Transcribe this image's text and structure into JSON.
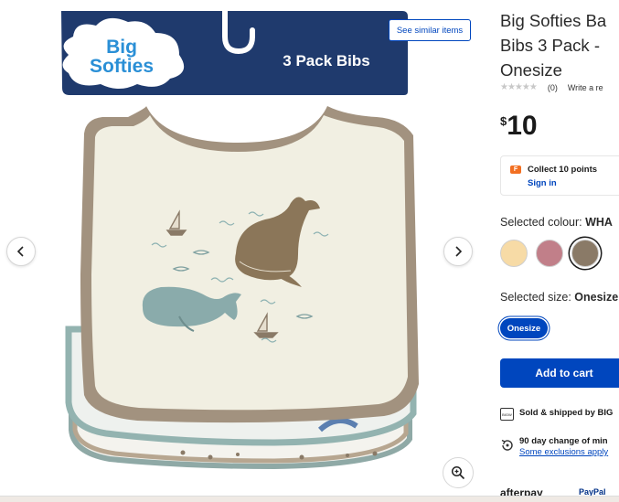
{
  "gallery": {
    "see_similar_label": "See similar items",
    "packaging": {
      "brand_line1": "Big",
      "brand_line2": "Softies",
      "pack_label": "3 Pack Bibs"
    }
  },
  "product": {
    "title_lines": [
      "Big Softies Ba",
      "Bibs 3 Pack - ",
      "Onesize"
    ],
    "rating": {
      "stars": "★★★★★",
      "count": "(0)",
      "write_review": "Write a re"
    },
    "price": {
      "currency": "$",
      "amount": "10"
    },
    "points": {
      "icon_letter": "F",
      "label": "Collect 10 points",
      "signin": "Sign in"
    },
    "colour": {
      "label": "Selected colour: ",
      "value": "WHA",
      "swatches": [
        {
          "name": "cream",
          "color": "#f7dba6"
        },
        {
          "name": "rose",
          "color": "#c17f89"
        },
        {
          "name": "taupe",
          "color": "#8a7a67"
        }
      ],
      "selected_index": 2
    },
    "size": {
      "label": "Selected size: ",
      "value": "Onesize",
      "pill": "Onesize"
    },
    "add_to_cart": "Add to cart",
    "sold_by": {
      "icon": "BIGW",
      "text": "Sold & shipped by BIG"
    },
    "returns": {
      "text": "90 day change of min",
      "link": "Some exclusions apply"
    },
    "payments": {
      "afterpay": "afterpay",
      "paypal": "PayPal"
    }
  },
  "colors": {
    "accent": "#0046be",
    "points": "#f26f21",
    "bib_trim": "#a2927f",
    "bib_body": "#f1efe2",
    "packaging": "#1f3a6d"
  }
}
